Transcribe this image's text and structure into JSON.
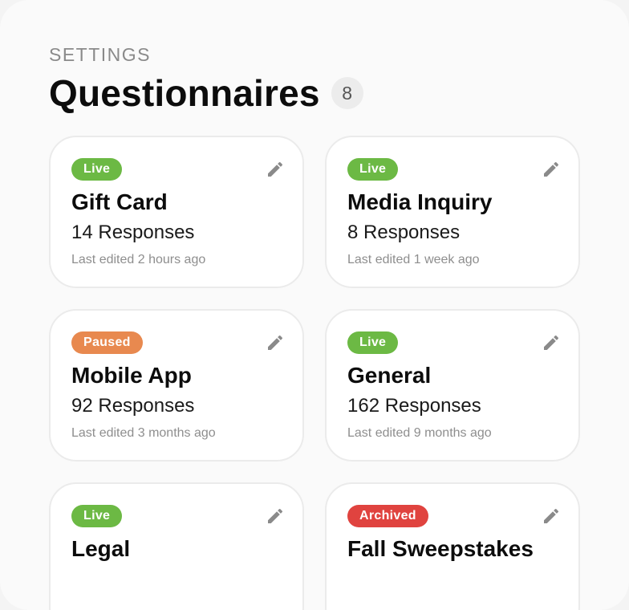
{
  "header": {
    "eyebrow": "SETTINGS",
    "title": "Questionnaires",
    "count": "8"
  },
  "colors": {
    "live": "#6cb944",
    "paused": "#e8894f",
    "archived": "#e0433f"
  },
  "cards": [
    {
      "status": "Live",
      "name": "Gift Card",
      "responses": "14 Responses",
      "edited": "Last edited 2 hours ago",
      "edit_icon": "pencil-icon"
    },
    {
      "status": "Live",
      "name": "Media Inquiry",
      "responses": "8 Responses",
      "edited": "Last edited 1 week ago",
      "edit_icon": "pencil-icon"
    },
    {
      "status": "Paused",
      "name": "Mobile App",
      "responses": "92 Responses",
      "edited": "Last edited 3 months ago",
      "edit_icon": "pencil-icon"
    },
    {
      "status": "Live",
      "name": "General",
      "responses": "162 Responses",
      "edited": "Last edited 9 months ago",
      "edit_icon": "pencil-icon"
    },
    {
      "status": "Live",
      "name": "Legal",
      "edit_icon": "pencil-icon"
    },
    {
      "status": "Archived",
      "name": "Fall Sweepstakes",
      "edit_icon": "pencil-icon"
    }
  ]
}
